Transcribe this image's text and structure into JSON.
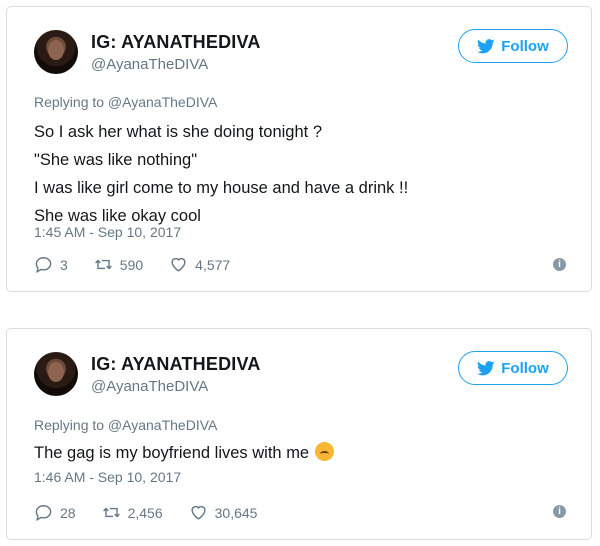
{
  "tweets": [
    {
      "display_name": "IG: AYANATHEDIVA",
      "handle": "@AyanaTheDIVA",
      "follow_label": "Follow",
      "replying_to": "Replying to @AyanaTheDIVA",
      "text_lines": [
        "So I ask her what is she doing tonight ?",
        "\"She was like nothing\"",
        "I was like girl come to my house and have a drink !!",
        "She was like okay cool"
      ],
      "timestamp": "1:45 AM - Sep 10, 2017",
      "replies": "3",
      "retweets": "590",
      "likes": "4,577"
    },
    {
      "display_name": "IG: AYANATHEDIVA",
      "handle": "@AyanaTheDIVA",
      "follow_label": "Follow",
      "replying_to": "Replying to @AyanaTheDIVA",
      "text_lines": [
        "The gag is my boyfriend lives with me"
      ],
      "timestamp": "1:46 AM - Sep 10, 2017",
      "replies": "28",
      "retweets": "2,456",
      "likes": "30,645"
    }
  ],
  "colors": {
    "accent": "#1da1f2",
    "muted": "#657786",
    "border": "#d7dde2"
  }
}
